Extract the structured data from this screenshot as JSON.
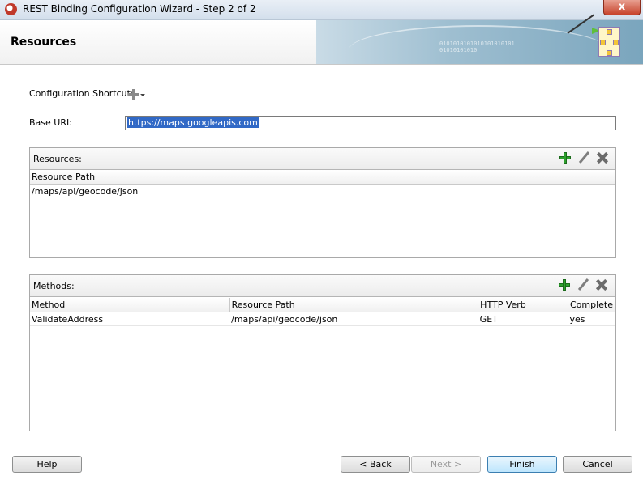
{
  "window": {
    "title": "REST Binding Configuration Wizard - Step 2 of 2",
    "close_label": "x"
  },
  "banner": {
    "title": "Resources",
    "binary_text": "0101010101010101010101\n01010101010"
  },
  "form": {
    "config_shortcut_label": "Configuration Shortcut:",
    "base_uri_label": "Base URI:",
    "base_uri_value": "https://maps.googleapis.com"
  },
  "resources": {
    "title": "Resources:",
    "columns": [
      "Resource Path"
    ],
    "rows": [
      [
        "/maps/api/geocode/json"
      ]
    ]
  },
  "methods": {
    "title": "Methods:",
    "columns": [
      "Method",
      "Resource Path",
      "HTTP Verb",
      "Complete"
    ],
    "rows": [
      [
        "ValidateAddress",
        "/maps/api/geocode/json",
        "GET",
        "yes"
      ]
    ]
  },
  "buttons": {
    "help": "Help",
    "back": "< Back",
    "next": "Next >",
    "finish": "Finish",
    "cancel": "Cancel"
  },
  "icons": {
    "add": "add-icon",
    "edit": "edit-icon",
    "delete": "delete-icon",
    "shortcut": "add-dropdown-icon"
  },
  "colors": {
    "selection": "#3169c6",
    "add_green": "#2ca02c"
  }
}
